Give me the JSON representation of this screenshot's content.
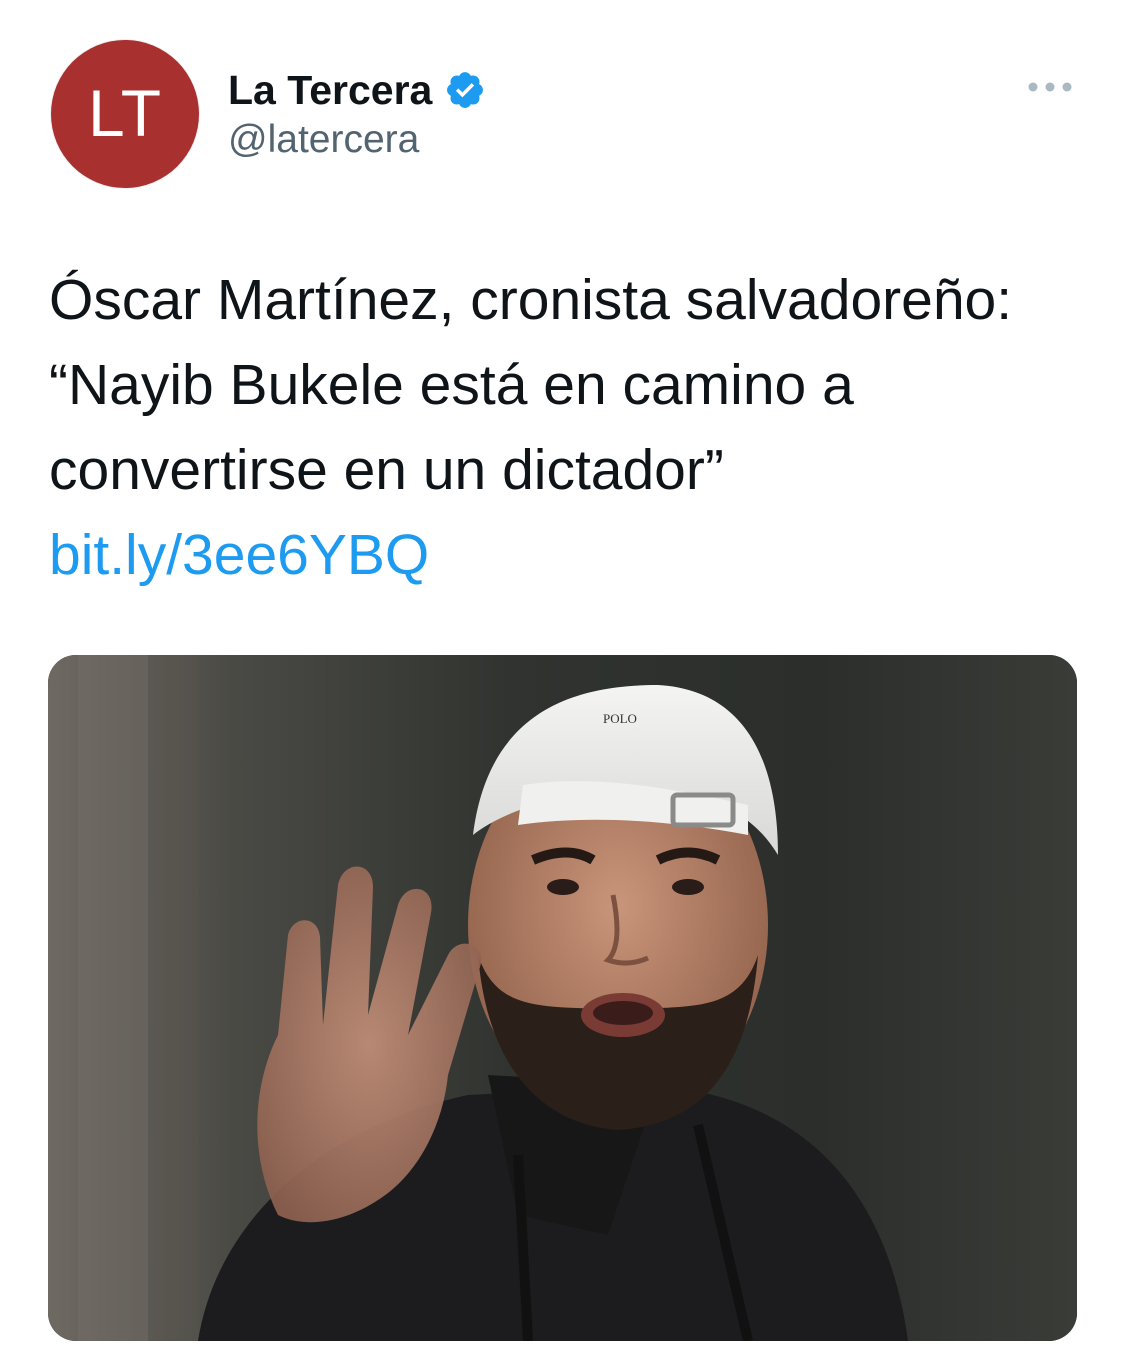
{
  "tweet": {
    "avatar_initials": "LT",
    "display_name": "La Tercera",
    "handle": "@latercera",
    "text": "Óscar Martínez, cronista salvadoreño: “Nayib Bukele está en camino a convertirse en un dictador”",
    "link": "bit.ly/3ee6YBQ",
    "media": {
      "cap_logo_text": "POLO"
    }
  },
  "icons": {
    "verified": "verified-badge-icon",
    "more": "more-options-icon"
  },
  "colors": {
    "avatar_bg": "#a8302f",
    "verified": "#1d9bf0",
    "link": "#1d9bf0",
    "secondary_text": "#536471",
    "primary_text": "#0f1419"
  }
}
